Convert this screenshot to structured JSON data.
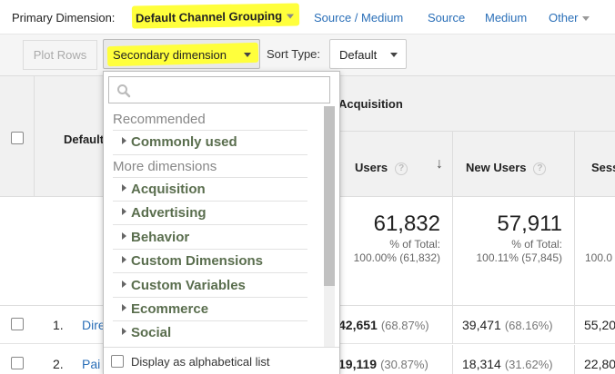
{
  "dimension_bar": {
    "label": "Primary Dimension:",
    "active": "Default Channel Grouping",
    "links": [
      "Source / Medium",
      "Source",
      "Medium",
      "Other"
    ]
  },
  "toolbar": {
    "plot_rows": "Plot Rows",
    "secondary_dimension": "Secondary dimension",
    "sort_type_label": "Sort Type:",
    "sort_type_value": "Default"
  },
  "table": {
    "dimension_header": "Default",
    "group_header": "Acquisition",
    "columns": [
      "Users",
      "New Users",
      "Sess"
    ],
    "totals": {
      "users": "61,832",
      "users_pct_label": "% of Total:",
      "users_pct": "100.00% (61,832)",
      "new_users": "57,911",
      "new_users_pct_label": "% of Total:",
      "new_users_pct": "100.11% (57,845)",
      "sessions_pct": "100.0"
    },
    "rows": [
      {
        "num": "1.",
        "name": "Dire",
        "users": "42,651",
        "users_pct": "(68.87%)",
        "new_users": "39,471",
        "new_users_pct": "(68.16%)",
        "sessions": "55,20"
      },
      {
        "num": "2.",
        "name": "Pai",
        "users": "19,119",
        "users_pct": "(30.87%)",
        "new_users": "18,314",
        "new_users_pct": "(31.62%)",
        "sessions": "22,80"
      }
    ]
  },
  "dropdown": {
    "search_placeholder": "",
    "recommended_heading": "Recommended",
    "recommended": [
      "Commonly used"
    ],
    "more_heading": "More dimensions",
    "more": [
      "Acquisition",
      "Advertising",
      "Behavior",
      "Custom Dimensions",
      "Custom Variables",
      "Ecommerce",
      "Social"
    ],
    "footer_checkbox": "Display as alphabetical list"
  },
  "colors": {
    "highlight": "#ffff3c",
    "link": "#2a6fb8",
    "dimension_item": "#5a6e4e"
  }
}
